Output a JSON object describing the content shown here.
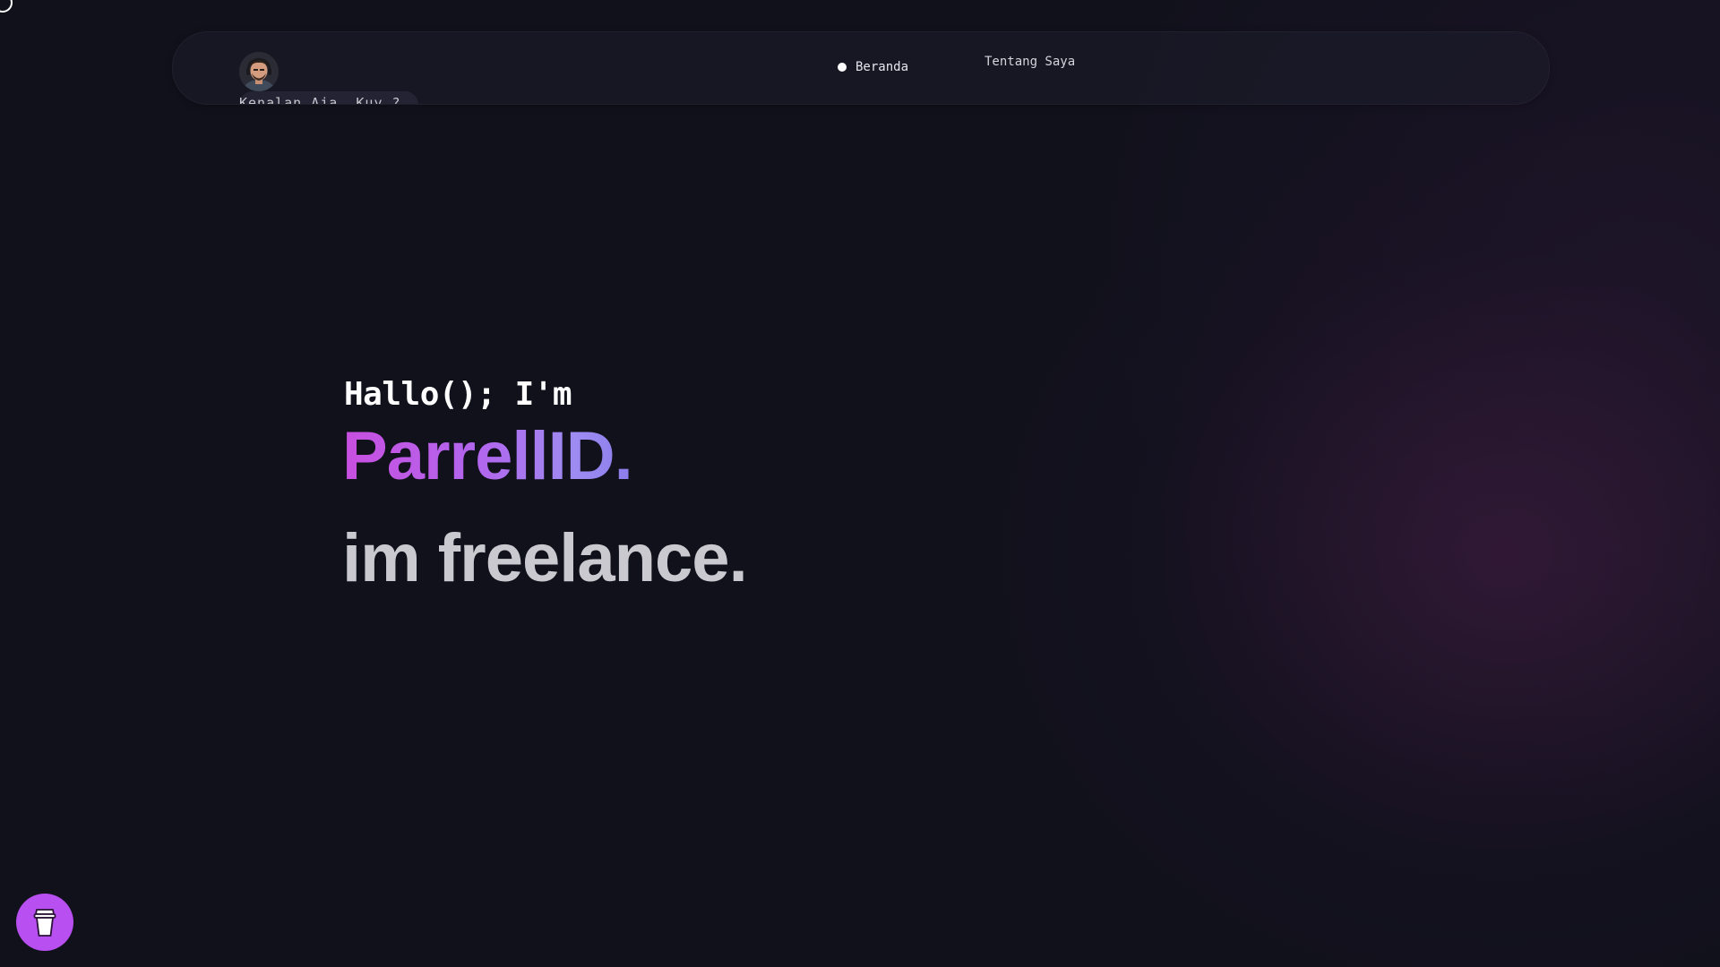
{
  "navbar": {
    "avatar_label": "Kenalan Aja, Kuy ?",
    "items": [
      {
        "label": "Beranda",
        "active": true
      },
      {
        "label": "Tentang Saya",
        "active": false
      }
    ]
  },
  "hero": {
    "greeting": "Hallo(); I'm",
    "name": "ParrellID.",
    "role": "im freelance."
  },
  "floating_button": {
    "icon": "coffee-cup-icon",
    "color": "#b84ff0"
  },
  "colors": {
    "background": "#11111c",
    "accent_gradient_start": "#c84fe0",
    "accent_gradient_end": "#8a7cea",
    "role_text": "#c9c9cf"
  }
}
